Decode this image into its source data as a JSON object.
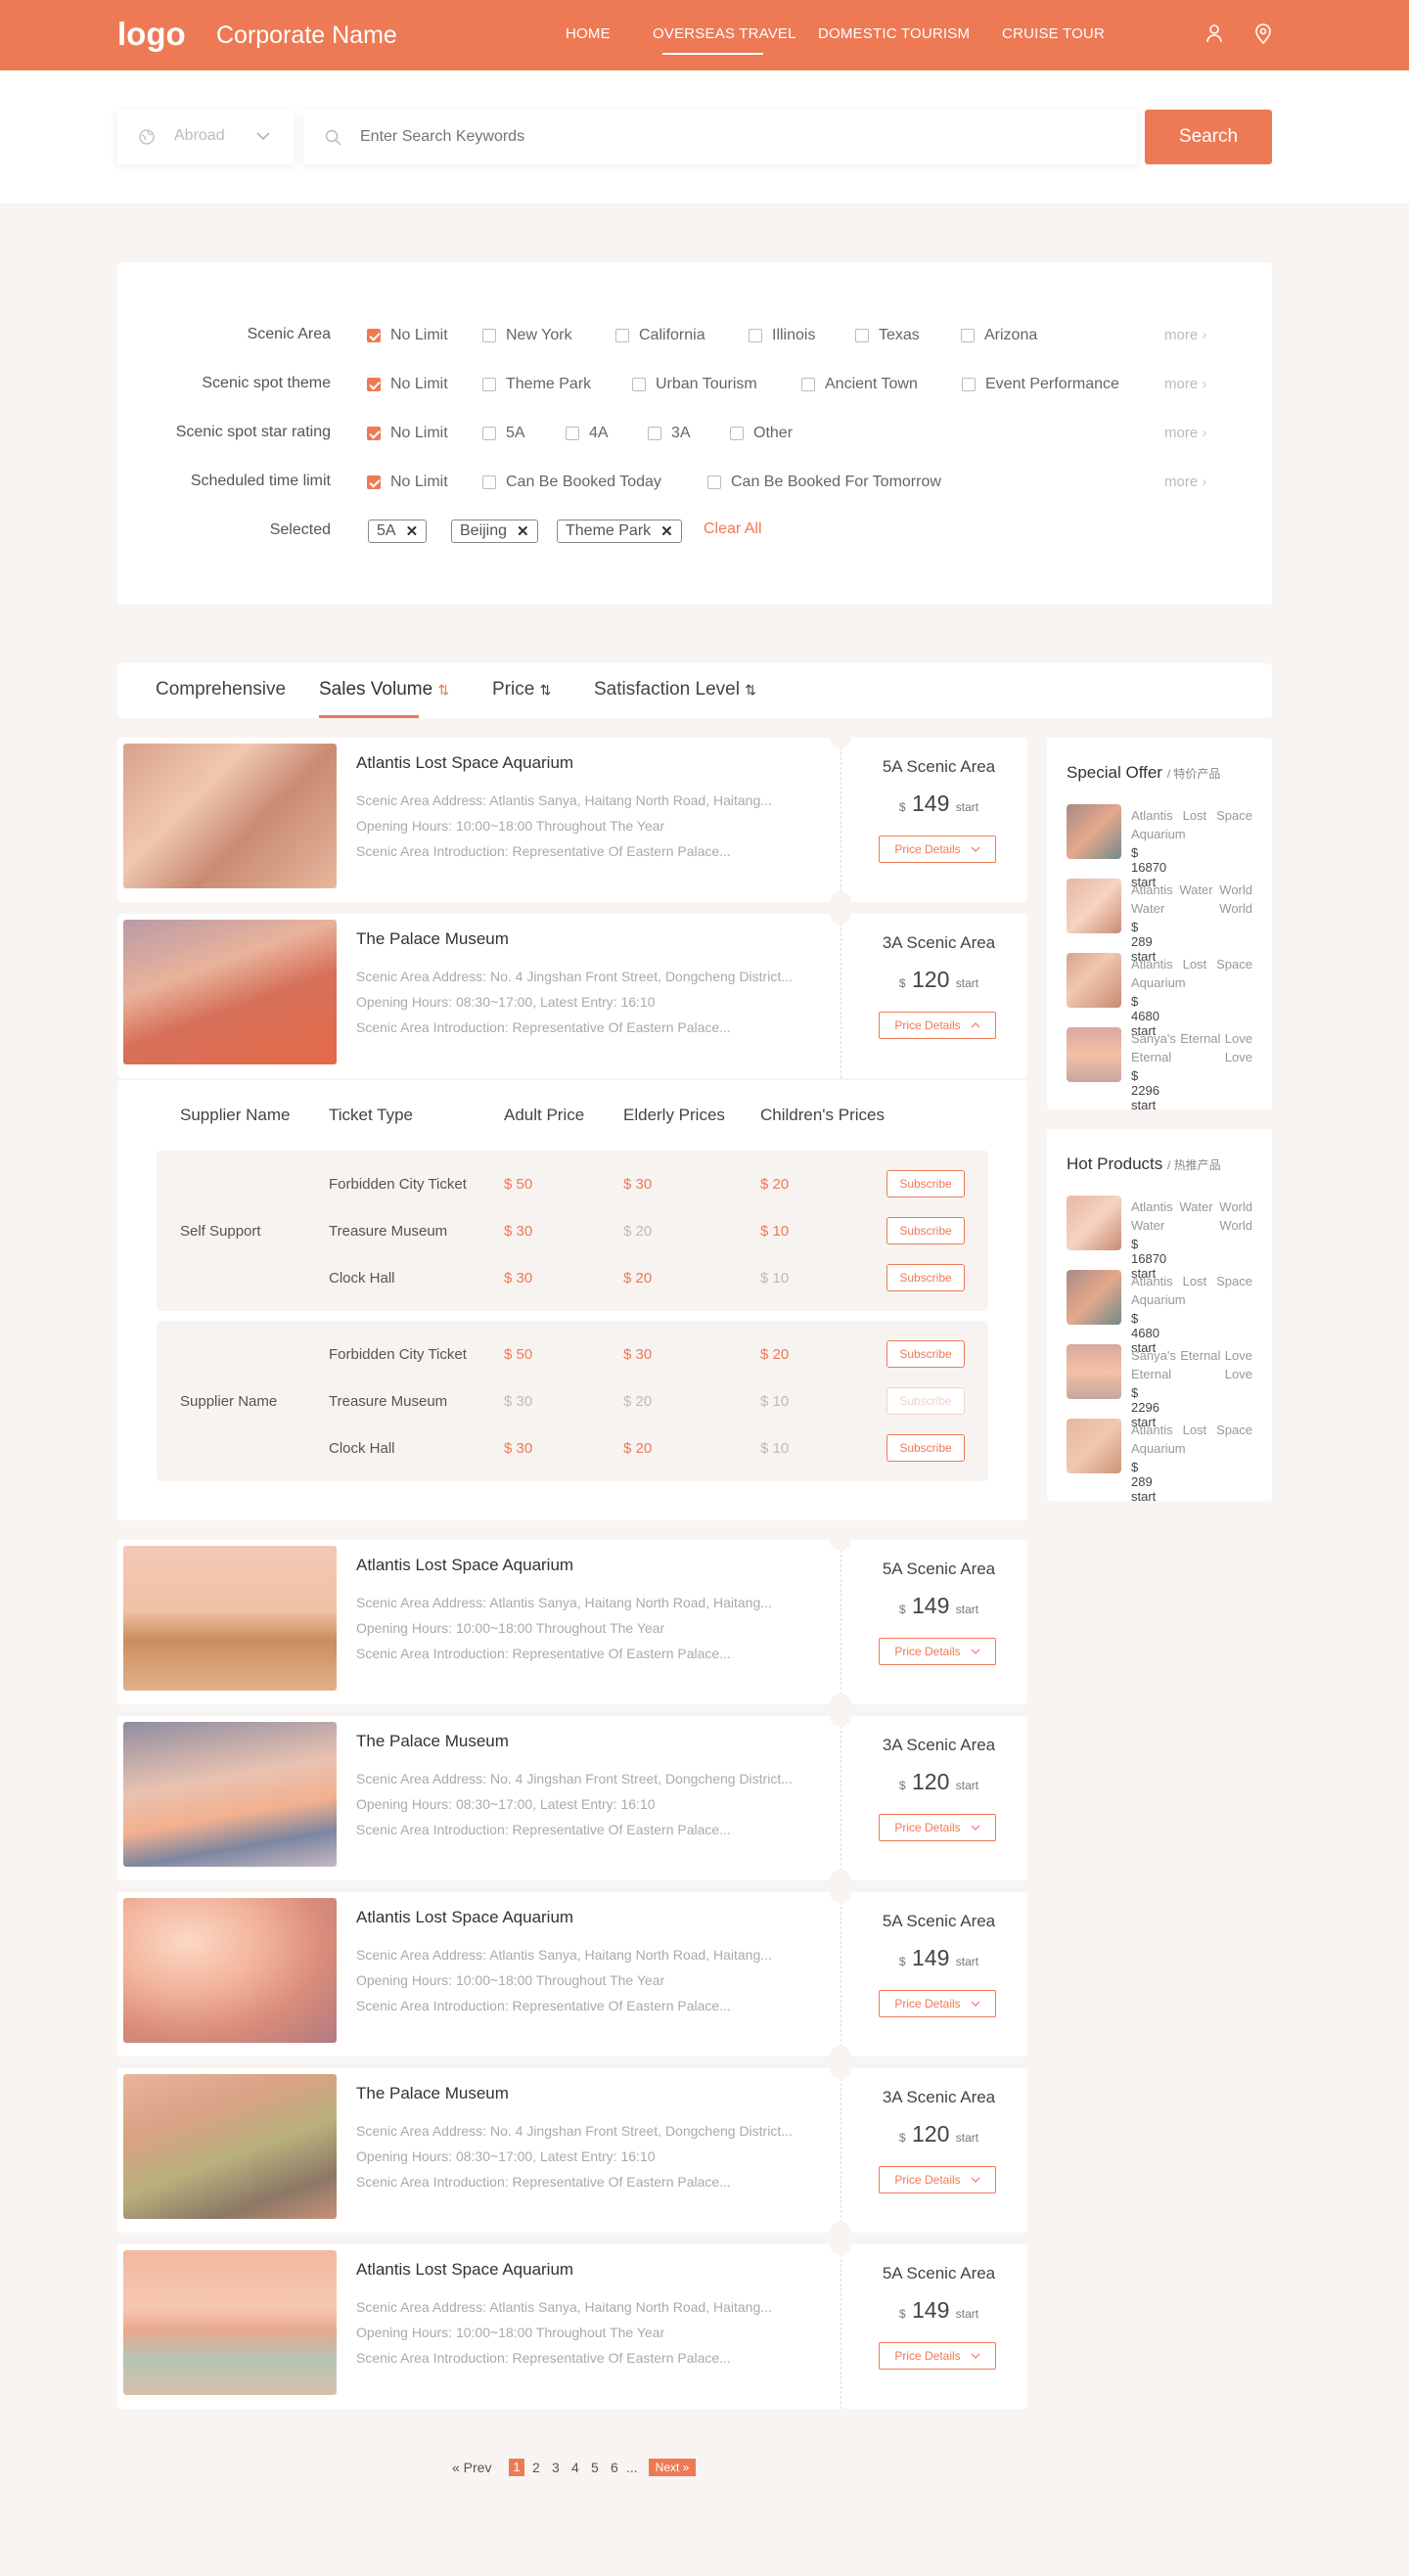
{
  "brand": {
    "logo": "logo",
    "corporate_name": "Corporate Name"
  },
  "nav": {
    "items": [
      "HOME",
      "OVERSEAS TRAVEL",
      "DOMESTIC TOURISM",
      "CRUISE TOUR"
    ],
    "active": "OVERSEAS TRAVEL"
  },
  "search": {
    "region": "Abroad",
    "placeholder": "Enter Search Keywords",
    "button": "Search"
  },
  "filters": {
    "rows": [
      {
        "label": "Scenic Area",
        "options": [
          "No Limit",
          "New York",
          "California",
          "Illinois",
          "Texas",
          "Arizona"
        ]
      },
      {
        "label": "Scenic spot theme",
        "options": [
          "No Limit",
          "Theme Park",
          "Urban Tourism",
          "Ancient Town",
          "Event Performance"
        ]
      },
      {
        "label": "Scenic spot star rating",
        "options": [
          "No Limit",
          "5A",
          "4A",
          "3A",
          "Other"
        ]
      },
      {
        "label": "Scheduled time limit",
        "options": [
          "No Limit",
          "Can Be Booked Today",
          "Can Be Booked For Tomorrow"
        ]
      }
    ],
    "more": "more",
    "selected_label": "Selected",
    "selected_tags": [
      "5A",
      "Beijing",
      "Theme Park"
    ],
    "clear_all": "Clear All"
  },
  "sort": {
    "items": [
      "Comprehensive",
      "Sales Volume",
      "Price",
      "Satisfaction Level"
    ],
    "active": "Sales Volume"
  },
  "cards": [
    {
      "name": "Atlantis Lost Space Aquarium",
      "address": "Scenic Area Address: Atlantis Sanya, Haitang North Road, Haitang...",
      "hours": "Opening Hours: 10:00~18:00 Throughout The Year",
      "intro": "Scenic Area Introduction: Representative Of Eastern Palace...",
      "grade": "5A Scenic Area",
      "currency": "$",
      "price": "149",
      "price_suffix": "start",
      "button": "Price Details"
    },
    {
      "name": "The Palace Museum",
      "address": "Scenic Area Address: No. 4 Jingshan Front Street, Dongcheng District...",
      "hours": "Opening Hours: 08:30~17:00, Latest Entry: 16:10",
      "intro": "Scenic Area Introduction: Representative Of Eastern Palace...",
      "grade": "3A Scenic Area",
      "currency": "$",
      "price": "120",
      "price_suffix": "start",
      "button": "Price Details"
    },
    {
      "name": "Atlantis Lost Space Aquarium",
      "address": "Scenic Area Address: Atlantis Sanya, Haitang North Road, Haitang...",
      "hours": "Opening Hours: 10:00~18:00 Throughout The Year",
      "intro": "Scenic Area Introduction: Representative Of Eastern Palace...",
      "grade": "5A Scenic Area",
      "currency": "$",
      "price": "149",
      "price_suffix": "start",
      "button": "Price Details"
    },
    {
      "name": "The Palace Museum",
      "address": "Scenic Area Address: No. 4 Jingshan Front Street, Dongcheng District...",
      "hours": "Opening Hours: 08:30~17:00, Latest Entry: 16:10",
      "intro": "Scenic Area Introduction: Representative Of Eastern Palace...",
      "grade": "3A Scenic Area",
      "currency": "$",
      "price": "120",
      "price_suffix": "start",
      "button": "Price Details"
    },
    {
      "name": "Atlantis Lost Space Aquarium",
      "address": "Scenic Area Address: Atlantis Sanya, Haitang North Road, Haitang...",
      "hours": "Opening Hours: 10:00~18:00 Throughout The Year",
      "intro": "Scenic Area Introduction: Representative Of Eastern Palace...",
      "grade": "5A Scenic Area",
      "currency": "$",
      "price": "149",
      "price_suffix": "start",
      "button": "Price Details"
    },
    {
      "name": "The Palace Museum",
      "address": "Scenic Area Address: No. 4 Jingshan Front Street, Dongcheng District...",
      "hours": "Opening Hours: 08:30~17:00, Latest Entry: 16:10",
      "intro": "Scenic Area Introduction: Representative Of Eastern Palace...",
      "grade": "3A Scenic Area",
      "currency": "$",
      "price": "120",
      "price_suffix": "start",
      "button": "Price Details"
    },
    {
      "name": "Atlantis Lost Space Aquarium",
      "address": "Scenic Area Address: Atlantis Sanya, Haitang North Road, Haitang...",
      "hours": "Opening Hours: 10:00~18:00 Throughout The Year",
      "intro": "Scenic Area Introduction: Representative Of Eastern Palace...",
      "grade": "5A Scenic Area",
      "currency": "$",
      "price": "149",
      "price_suffix": "start",
      "button": "Price Details"
    }
  ],
  "detail": {
    "headers": [
      "Supplier Name",
      "Ticket Type",
      "Adult Price",
      "Elderly Prices",
      "Children's Prices"
    ],
    "groups": [
      {
        "supplier": "Self Support",
        "rows": [
          {
            "type": "Forbidden City Ticket",
            "adult": "$ 50",
            "elderly": "$ 30",
            "children": "$ 20",
            "button": "Subscribe"
          },
          {
            "type": "Treasure Museum",
            "adult": "$ 30",
            "elderly": "$ 20",
            "children": "$ 10",
            "button": "Subscribe"
          },
          {
            "type": "Clock Hall",
            "adult": "$ 30",
            "elderly": "$ 20",
            "children": "$ 10",
            "button": "Subscribe"
          }
        ]
      },
      {
        "supplier": "Supplier Name",
        "rows": [
          {
            "type": "Forbidden City Ticket",
            "adult": "$ 50",
            "elderly": "$ 30",
            "children": "$ 20",
            "button": "Subscribe"
          },
          {
            "type": "Treasure Museum",
            "adult": "$ 30",
            "elderly": "$ 20",
            "children": "$ 10",
            "button": "Subscribe"
          },
          {
            "type": "Clock Hall",
            "adult": "$ 30",
            "elderly": "$ 20",
            "children": "$ 10",
            "button": "Subscribe"
          }
        ]
      }
    ]
  },
  "special_offer": {
    "title": "Special Offer",
    "subtitle": "/ 特价产品",
    "items": [
      {
        "name": "Atlantis Lost Space Aquarium",
        "price": "$ 16870 start"
      },
      {
        "name": "Atlantis Water World Water World",
        "price": "$ 289 start"
      },
      {
        "name": "Atlantis Lost Space Aquarium",
        "price": "$ 4680 start"
      },
      {
        "name": "Sanya's Eternal Love Eternal Love",
        "price": "$ 2296 start"
      }
    ]
  },
  "hot_products": {
    "title": "Hot Products",
    "subtitle": "/ 热推产品",
    "items": [
      {
        "name": "Atlantis Water World Water World",
        "price": "$ 16870 start"
      },
      {
        "name": "Atlantis Lost Space Aquarium",
        "price": "$ 4680 start"
      },
      {
        "name": "Sanya's Eternal Love Eternal Love",
        "price": "$ 2296 start"
      },
      {
        "name": "Atlantis Lost Space Aquarium",
        "price": "$ 289 start"
      }
    ]
  },
  "pagination": {
    "prev": "« Prev",
    "pages": [
      "1",
      "2",
      "3",
      "4",
      "5",
      "6"
    ],
    "ellipsis": "...",
    "next": "Next »",
    "current": "1"
  },
  "colors": {
    "accent": "#ed7a55",
    "background": "#f8f4f2"
  }
}
